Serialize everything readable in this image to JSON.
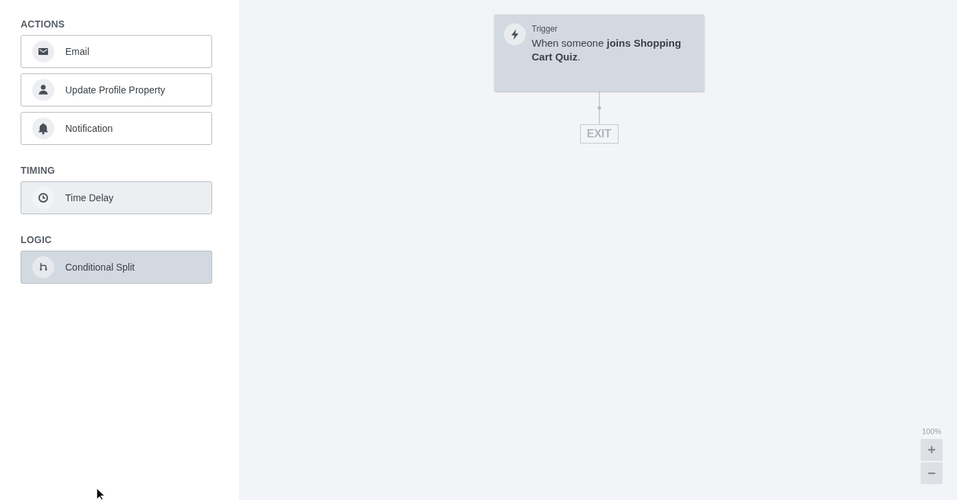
{
  "sidebar": {
    "sections": [
      {
        "heading": "ACTIONS",
        "kind": "action",
        "items": [
          {
            "label": "Email",
            "kind": "email"
          },
          {
            "label": "Update Profile Property",
            "kind": "profile"
          },
          {
            "label": "Notification",
            "kind": "notification"
          }
        ]
      },
      {
        "heading": "TIMING",
        "kind": "timing",
        "items": [
          {
            "label": "Time Delay",
            "kind": "delay"
          }
        ]
      },
      {
        "heading": "LOGIC",
        "kind": "logic",
        "items": [
          {
            "label": "Conditional Split",
            "kind": "split"
          }
        ]
      }
    ]
  },
  "canvas": {
    "trigger": {
      "label": "Trigger",
      "text": "When someone **joins Shopping Cart Quiz**."
    },
    "exit": {
      "label": "EXIT"
    },
    "zoom": {
      "level_text": "100%",
      "zoom_in": "+",
      "zoom_out": "−"
    }
  }
}
